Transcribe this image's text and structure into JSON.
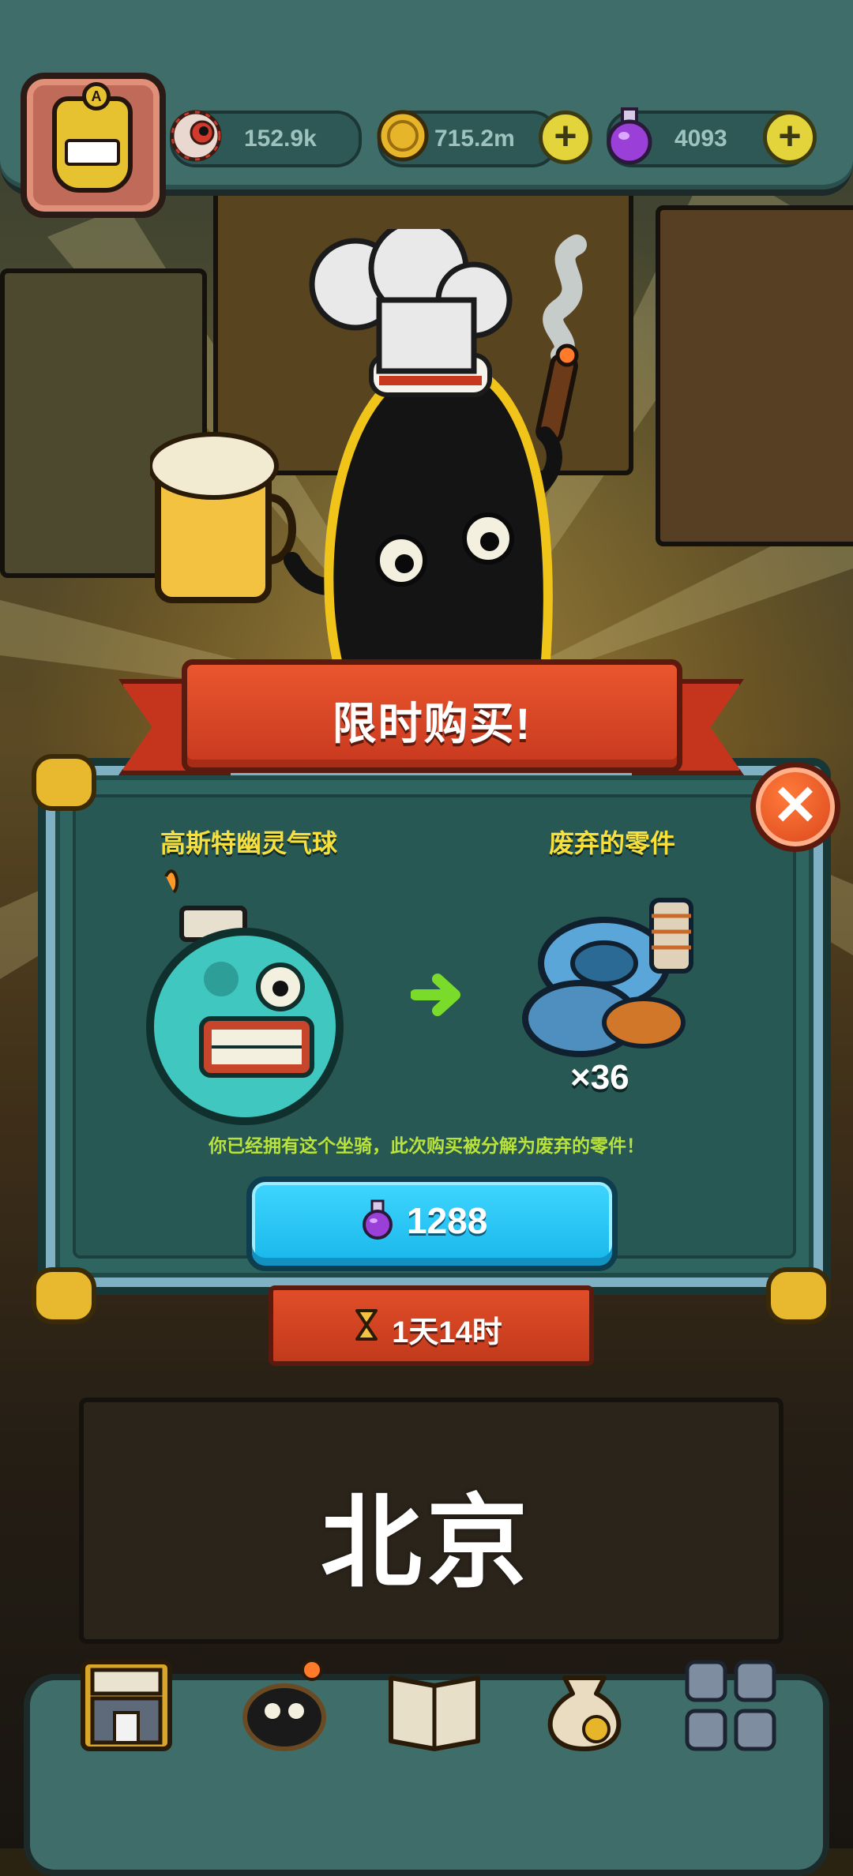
{
  "resources": {
    "eyeballs": "152.9k",
    "coins": "715.2m",
    "potions": "4093"
  },
  "popup": {
    "title": "限时购买!",
    "from_item": "高斯特幽灵气球",
    "to_item": "废弃的零件",
    "quantity": "×36",
    "notice": "你已经拥有这个坐骑，此次购买被分解为废弃的零件！",
    "price": "1288",
    "timer": "1天14时",
    "close_label": "✕"
  },
  "overlay_text": "北京",
  "icons": {
    "eyeball": "eyeball-icon",
    "coin": "coin-icon",
    "potion": "potion-icon",
    "hourglass": "hourglass-icon",
    "arrow": "arrow-right-icon"
  },
  "colors": {
    "panel": "#2f6560",
    "ribbon": "#d8431a",
    "button": "#18b6ea",
    "highlight": "#f7e03c",
    "notice": "#b9e23a"
  }
}
